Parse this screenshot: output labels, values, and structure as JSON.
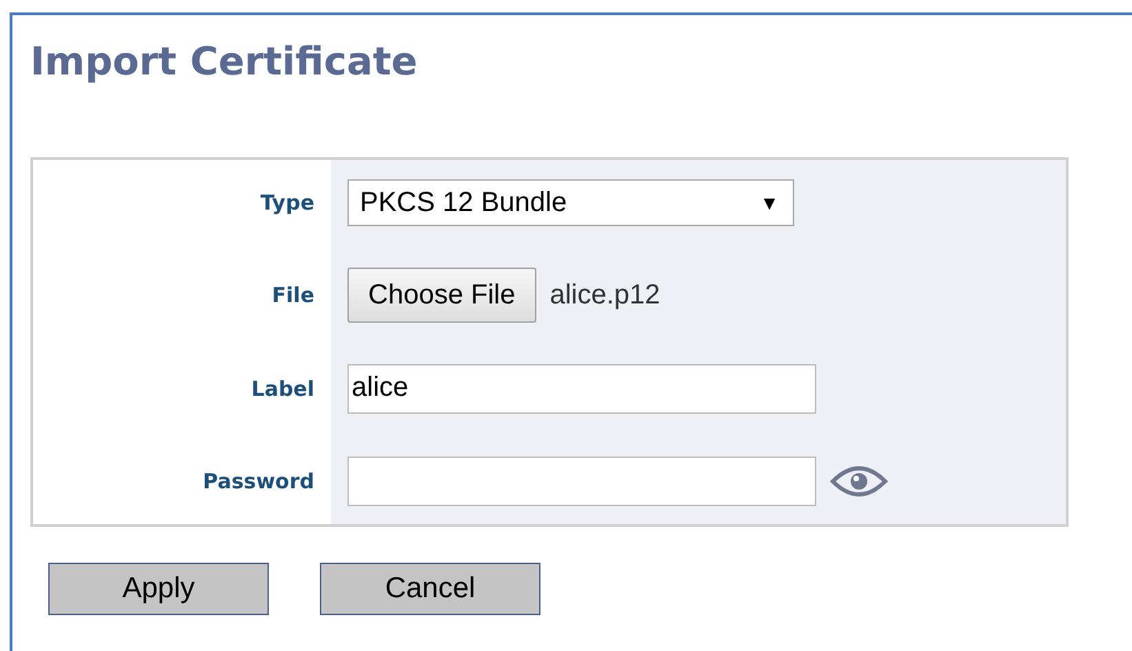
{
  "title": "Import Certificate",
  "fields": [
    {
      "kind": "select",
      "label": "Type",
      "value": "PKCS 12 Bundle",
      "arrow": "▼"
    },
    {
      "kind": "file",
      "label": "File",
      "button": "Choose File",
      "value": "alice.p12"
    },
    {
      "kind": "text",
      "label": "Label",
      "value": "alice"
    },
    {
      "kind": "password",
      "label": "Password"
    }
  ],
  "buttons": [
    "Apply",
    "Cancel"
  ]
}
